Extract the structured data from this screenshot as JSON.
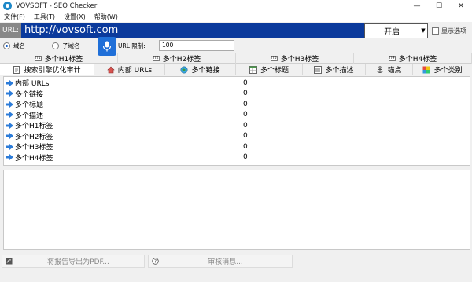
{
  "window": {
    "title": "VOVSOFT - SEO Checker",
    "minimize": "—",
    "maximize": "☐",
    "close": "✕"
  },
  "menu": [
    "文件(F)",
    "工具(T)",
    "设置(X)",
    "帮助(W)"
  ],
  "url_bar": {
    "label": "URL:",
    "value": "http://vovsoft.com",
    "start_label": "开启",
    "dropdown": "▼",
    "show_options_label": "显示选项"
  },
  "options": {
    "domain_label": "域名",
    "subdomain_label": "子域名",
    "limit_label": "URL 限制:",
    "limit_value": "100",
    "selected": "domain"
  },
  "heading_tabs": [
    "多个H1标签",
    "多个H2标签",
    "多个H3标签",
    "多个H4标签"
  ],
  "main_tabs": [
    {
      "label": "搜索引擎优化审计",
      "icon": "document-icon",
      "active": true
    },
    {
      "label": "内部 URLs",
      "icon": "house-icon"
    },
    {
      "label": "多个链接",
      "icon": "globe-icon"
    },
    {
      "label": "多个标题",
      "icon": "table-icon"
    },
    {
      "label": "多个描述",
      "icon": "list-icon"
    },
    {
      "label": "锚点",
      "icon": "anchor-icon"
    },
    {
      "label": "多个类别",
      "icon": "palette-icon"
    }
  ],
  "audit_rows": [
    {
      "name": "内部 URLs",
      "value": "0"
    },
    {
      "name": "多个链接",
      "value": "0"
    },
    {
      "name": "多个标题",
      "value": "0"
    },
    {
      "name": "多个描述",
      "value": "0"
    },
    {
      "name": "多个H1标签",
      "value": "0"
    },
    {
      "name": "多个H2标签",
      "value": "0"
    },
    {
      "name": "多个H3标签",
      "value": "0"
    },
    {
      "name": "多个H4标签",
      "value": "0"
    }
  ],
  "bottom": {
    "export_label": "将报告导出为PDF...",
    "review_label": "审核消息..."
  },
  "colors": {
    "url_bg": "#0b3a9c",
    "mic_bg": "#1f6fd8",
    "arrow": "#2b7bd8"
  }
}
